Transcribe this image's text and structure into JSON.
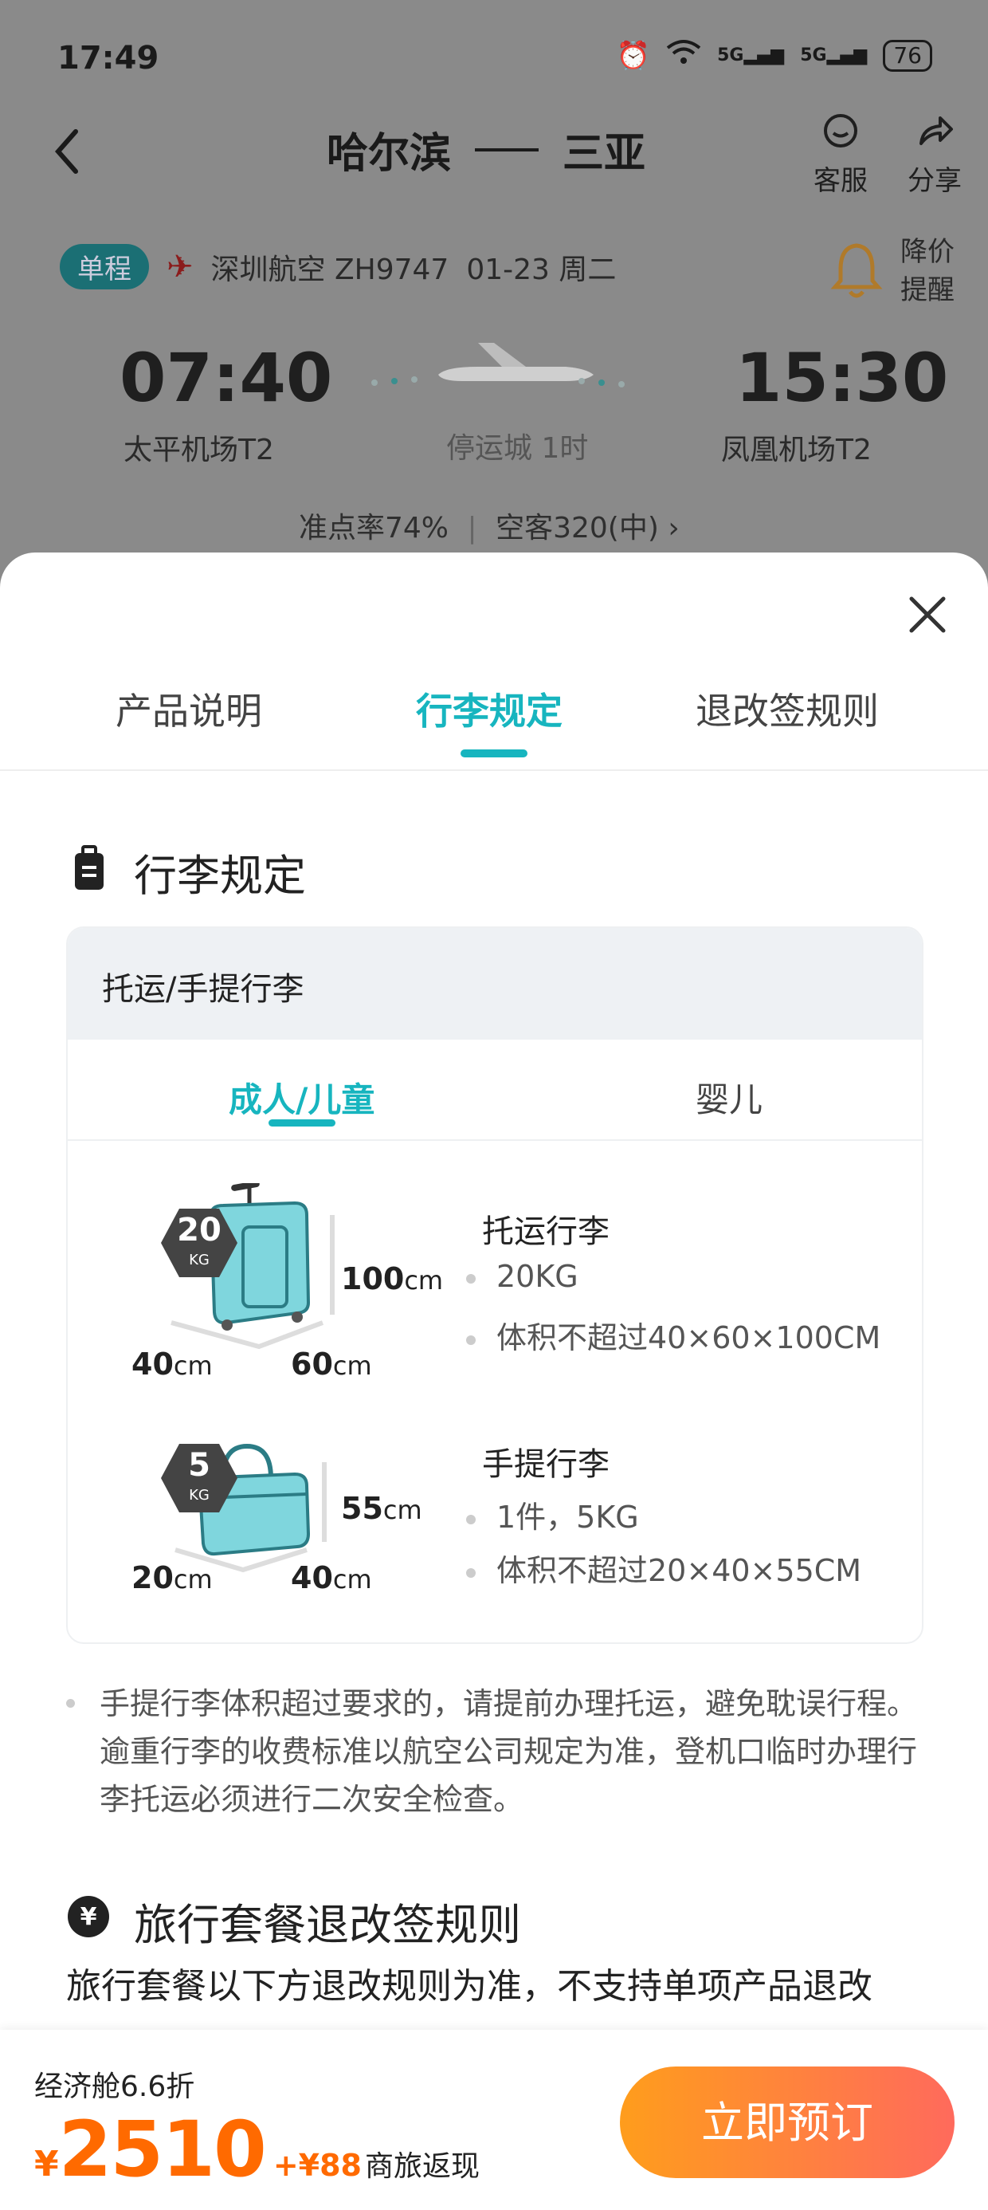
{
  "status_bar": {
    "time": "17:49",
    "network1": "5G",
    "network2": "5G",
    "battery": "76"
  },
  "header": {
    "origin": "哈尔滨",
    "destination": "三亚",
    "service_label": "客服",
    "share_label": "分享"
  },
  "flight": {
    "trip_type": "单程",
    "airline_flight": "深圳航空 ZH9747",
    "date": "01-23 周二",
    "price_alert_line1": "降价",
    "price_alert_line2": "提醒",
    "departure_time": "07:40",
    "departure_airport": "太平机场T2",
    "arrival_time": "15:30",
    "arrival_airport": "凤凰机场T2",
    "stopover": "停运城 1时",
    "on_time_rate": "准点率74%",
    "aircraft": "空客320(中)"
  },
  "sheet": {
    "tabs": [
      "产品说明",
      "行李规定",
      "退改签规则"
    ],
    "active_tab": "行李规定",
    "section_title": "行李规定",
    "card_header": "托运/手提行李",
    "passenger_tabs": [
      "成人/儿童",
      "婴儿"
    ],
    "checked": {
      "weight": "20",
      "weight_unit": "KG",
      "height": "100",
      "width": "40",
      "depth": "60",
      "unit": "cm",
      "title": "托运行李",
      "items": [
        "20KG",
        "体积不超过40×60×100CM"
      ]
    },
    "carry_on": {
      "weight": "5",
      "weight_unit": "KG",
      "height": "55",
      "width": "20",
      "depth": "40",
      "unit": "cm",
      "title": "手提行李",
      "items": [
        "1件，5KG",
        "体积不超过20×40×55CM"
      ]
    },
    "note": "手提行李体积超过要求的，请提前办理托运，避免耽误行程。逾重行李的收费标准以航空公司规定为准，登机口临时办理行李托运必须进行二次安全检查。",
    "package_title": "旅行套餐退改签规则",
    "package_text": "旅行套餐以下方退改规则为准，不支持单项产品退改"
  },
  "bottom": {
    "cabin_discount": "经济舱6.6折",
    "currency": "¥",
    "price": "2510",
    "cashback_prefix": "+¥88",
    "cashback_label": "商旅返现",
    "book_label": "立即预订"
  },
  "colors": {
    "accent": "#17b5bf",
    "price": "#ff6a00",
    "book_start": "#ff9d1c",
    "book_end": "#ff6a5c"
  }
}
